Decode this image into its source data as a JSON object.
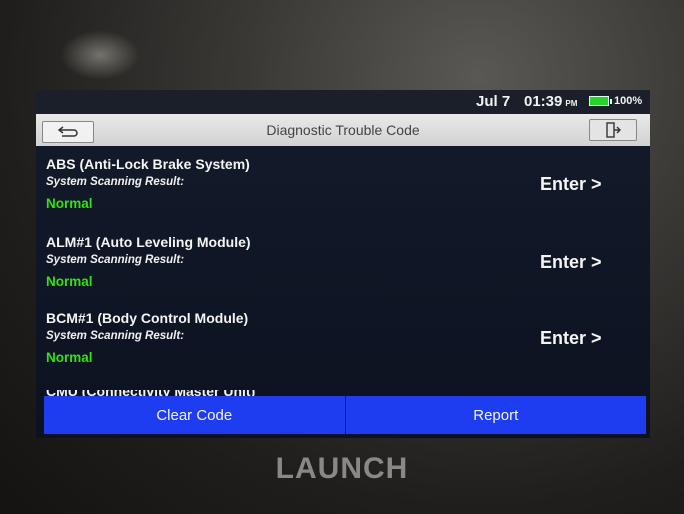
{
  "status": {
    "date": "Jul 7",
    "time": "01:39",
    "ampm": "PM",
    "battery": "100%",
    "battery_color": "#27d22a"
  },
  "header": {
    "title": "Diagnostic Trouble Code",
    "back_icon": "back-arrow-icon",
    "exit_icon": "exit-icon"
  },
  "items": [
    {
      "name": "ABS (Anti-Lock Brake System)",
      "sub": "System Scanning Result:",
      "result": "Normal",
      "action": "Enter >"
    },
    {
      "name": "ALM#1 (Auto Leveling Module)",
      "sub": "System Scanning Result:",
      "result": "Normal",
      "action": "Enter >"
    },
    {
      "name": "BCM#1 (Body Control Module)",
      "sub": "System Scanning Result:",
      "result": "Normal",
      "action": "Enter >"
    },
    {
      "name": "CMU (Connectivity Master Unit)"
    }
  ],
  "footer": {
    "clear": "Clear Code",
    "report": "Report",
    "accent": "#1f3df0"
  },
  "brand": "LAUNCH"
}
